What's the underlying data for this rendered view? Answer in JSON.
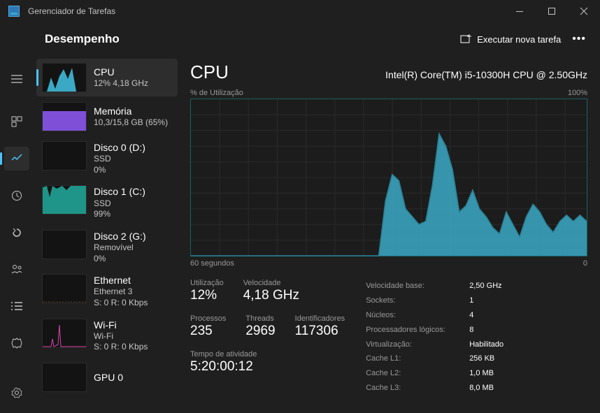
{
  "window": {
    "title": "Gerenciador de Tarefas"
  },
  "header": {
    "pageTitle": "Desempenho",
    "runTask": "Executar nova tarefa"
  },
  "sidebar": [
    {
      "name": "CPU",
      "sub1": "12% 4,18 GHz",
      "sub2": ""
    },
    {
      "name": "Memória",
      "sub1": "10,3/15,8 GB (65%)",
      "sub2": ""
    },
    {
      "name": "Disco 0 (D:)",
      "sub1": "SSD",
      "sub2": "0%"
    },
    {
      "name": "Disco 1 (C:)",
      "sub1": "SSD",
      "sub2": "99%"
    },
    {
      "name": "Disco 2 (G:)",
      "sub1": "Removível",
      "sub2": "0%"
    },
    {
      "name": "Ethernet",
      "sub1": "Ethernet 3",
      "sub2": "S: 0 R: 0 Kbps"
    },
    {
      "name": "Wi-Fi",
      "sub1": "Wi-Fi",
      "sub2": "S: 0 R: 0 Kbps"
    },
    {
      "name": "GPU 0",
      "sub1": "",
      "sub2": ""
    }
  ],
  "main": {
    "title": "CPU",
    "model": "Intel(R) Core(TM) i5-10300H CPU @ 2.50GHz",
    "chartTopLeft": "% de Utilização",
    "chartTopRight": "100%",
    "chartBotLeft": "60 segundos",
    "chartBotRight": "0",
    "stats": {
      "util": {
        "lbl": "Utilização",
        "val": "12%"
      },
      "speed": {
        "lbl": "Velocidade",
        "val": "4,18 GHz"
      },
      "proc": {
        "lbl": "Processos",
        "val": "235"
      },
      "threads": {
        "lbl": "Threads",
        "val": "2969"
      },
      "handles": {
        "lbl": "Identificadores",
        "val": "117306"
      },
      "uptime": {
        "lbl": "Tempo de atividade",
        "val": "5:20:00:12"
      }
    },
    "info": [
      {
        "lbl": "Velocidade base:",
        "val": "2,50 GHz"
      },
      {
        "lbl": "Sockets:",
        "val": "1"
      },
      {
        "lbl": "Núcleos:",
        "val": "4"
      },
      {
        "lbl": "Processadores lógicos:",
        "val": "8"
      },
      {
        "lbl": "Virtualização:",
        "val": "Habilitado"
      },
      {
        "lbl": "Cache L1:",
        "val": "256 KB"
      },
      {
        "lbl": "Cache L2:",
        "val": "1,0 MB"
      },
      {
        "lbl": "Cache L3:",
        "val": "8,0 MB"
      }
    ]
  },
  "chart_data": {
    "type": "area",
    "title": "% de Utilização",
    "ylim": [
      0,
      100
    ],
    "xrange_seconds": [
      60,
      0
    ],
    "values": [
      0,
      0,
      0,
      0,
      0,
      0,
      0,
      0,
      0,
      0,
      0,
      0,
      0,
      0,
      0,
      0,
      0,
      0,
      0,
      0,
      0,
      0,
      0,
      0,
      0,
      0,
      0,
      0,
      0,
      35,
      52,
      48,
      30,
      25,
      20,
      22,
      45,
      78,
      70,
      55,
      28,
      32,
      42,
      30,
      25,
      18,
      14,
      28,
      20,
      12,
      25,
      33,
      28,
      20,
      15,
      22,
      26,
      22,
      26,
      22
    ]
  }
}
